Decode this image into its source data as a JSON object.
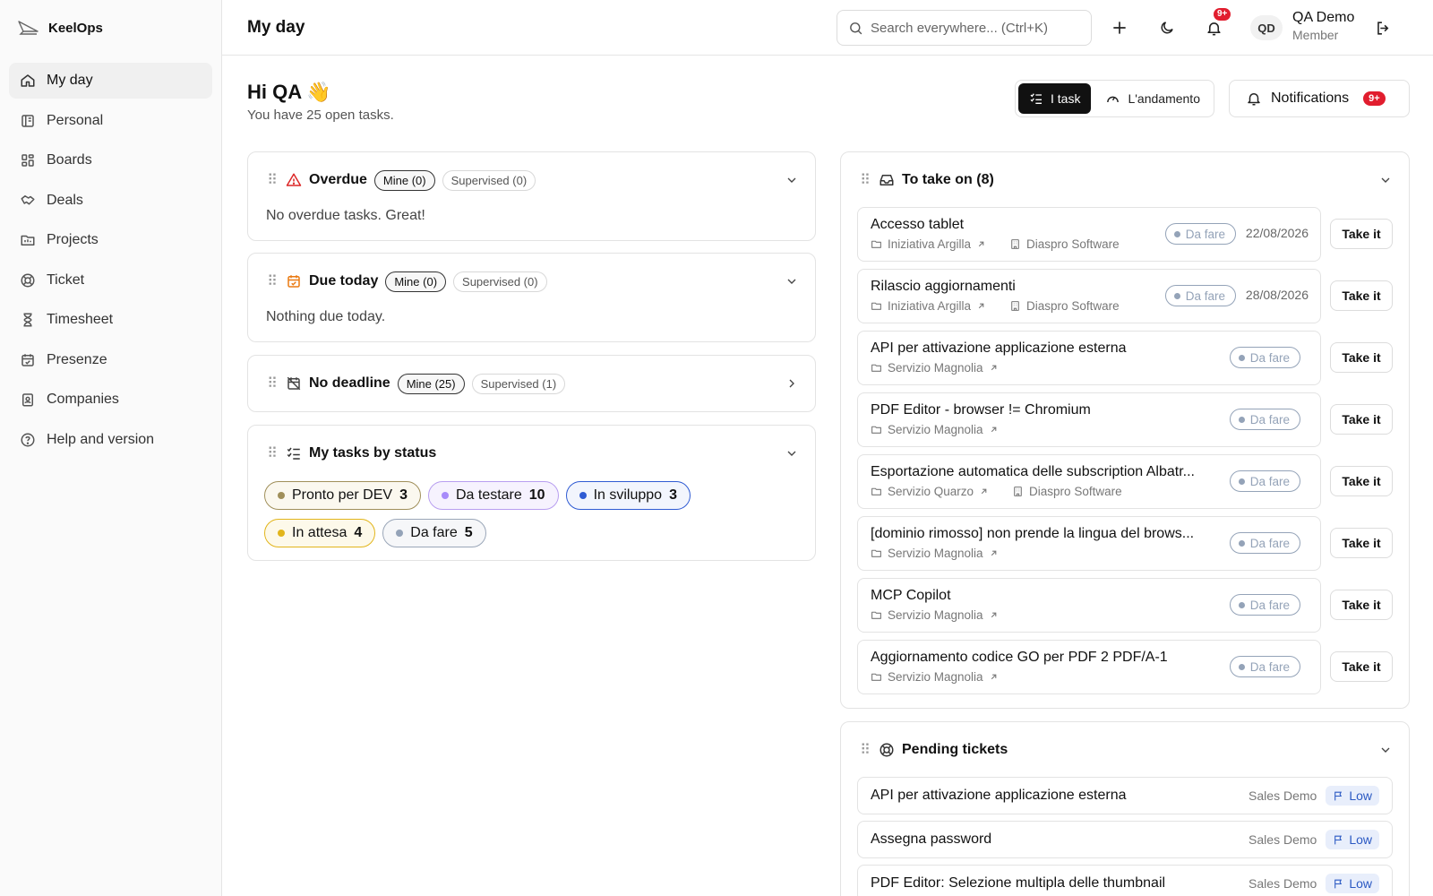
{
  "app": {
    "name": "KeelOps"
  },
  "sidebar": {
    "items": [
      {
        "label": "My day",
        "icon": "home-icon"
      },
      {
        "label": "Personal",
        "icon": "personal-board-icon"
      },
      {
        "label": "Boards",
        "icon": "boards-icon"
      },
      {
        "label": "Deals",
        "icon": "handshake-icon"
      },
      {
        "label": "Projects",
        "icon": "folder-icon"
      },
      {
        "label": "Ticket",
        "icon": "lifebuoy-icon"
      },
      {
        "label": "Timesheet",
        "icon": "hourglass-icon"
      },
      {
        "label": "Presenze",
        "icon": "calendar-check-icon"
      },
      {
        "label": "Companies",
        "icon": "building-icon"
      },
      {
        "label": "Help and version",
        "icon": "help-icon"
      }
    ]
  },
  "header": {
    "title": "My day",
    "search_placeholder": "Search everywhere... (Ctrl+K)",
    "bell_badge": "9+",
    "user": {
      "initials": "QD",
      "name": "QA Demo",
      "role": "Member"
    }
  },
  "greeting": {
    "title": "Hi QA 👋",
    "subtitle": "You have 25 open tasks."
  },
  "view_toggle": {
    "tasks": "I task",
    "progress": "L'andamento"
  },
  "notifications": {
    "label": "Notifications",
    "badge": "9+"
  },
  "overdue": {
    "title": "Overdue",
    "mine": "Mine (0)",
    "supervised": "Supervised (0)",
    "text": "No overdue tasks. Great!"
  },
  "due_today": {
    "title": "Due today",
    "mine": "Mine (0)",
    "supervised": "Supervised (0)",
    "text": "Nothing due today."
  },
  "no_deadline": {
    "title": "No deadline",
    "mine": "Mine (25)",
    "supervised": "Supervised (1)"
  },
  "by_status": {
    "title": "My tasks by status",
    "chips": [
      {
        "label": "Pronto per DEV",
        "count": "3",
        "color": "#a08f5a",
        "dot": "#a08f5a",
        "bg": "#fbf8ef"
      },
      {
        "label": "Da testare",
        "count": "10",
        "color": "#b89ef0",
        "dot": "#a78bfa",
        "bg": "#f6f2fe"
      },
      {
        "label": "In sviluppo",
        "count": "3",
        "color": "#2f5bd3",
        "dot": "#2f5bd3",
        "bg": "#f2f5fd"
      },
      {
        "label": "In attesa",
        "count": "4",
        "color": "#e2b51b",
        "dot": "#e2b51b",
        "bg": "#fdf9ea"
      },
      {
        "label": "Da fare",
        "count": "5",
        "color": "#9aa6b8",
        "dot": "#94a3b8",
        "bg": "#f6f7f9"
      }
    ]
  },
  "take_on": {
    "title": "To take on (8)",
    "take_label": "Take it",
    "tasks": [
      {
        "title": "Accesso tablet",
        "project": "Iniziativa Argilla",
        "company": "Diaspro Software",
        "status": "Da fare",
        "date": "22/08/2026"
      },
      {
        "title": "Rilascio aggiornamenti",
        "project": "Iniziativa Argilla",
        "company": "Diaspro Software",
        "status": "Da fare",
        "date": "28/08/2026"
      },
      {
        "title": "API per attivazione applicazione esterna",
        "project": "Servizio Magnolia",
        "company": "",
        "status": "Da fare",
        "date": ""
      },
      {
        "title": "PDF Editor - browser != Chromium",
        "project": "Servizio Magnolia",
        "company": "",
        "status": "Da fare",
        "date": ""
      },
      {
        "title": "Esportazione automatica delle subscription Albatr...",
        "project": "Servizio Quarzo",
        "company": "Diaspro Software",
        "status": "Da fare",
        "date": ""
      },
      {
        "title": "[dominio rimosso] non prende la lingua del brows...",
        "project": "Servizio Magnolia",
        "company": "",
        "status": "Da fare",
        "date": ""
      },
      {
        "title": "MCP Copilot",
        "project": "Servizio Magnolia",
        "company": "",
        "status": "Da fare",
        "date": ""
      },
      {
        "title": "Aggiornamento codice GO per PDF 2 PDF/A-1",
        "project": "Servizio Magnolia",
        "company": "",
        "status": "Da fare",
        "date": ""
      }
    ]
  },
  "pending_tickets": {
    "title": "Pending tickets",
    "tickets": [
      {
        "title": "API per attivazione applicazione esterna",
        "company": "Sales Demo",
        "priority": "Low"
      },
      {
        "title": "Assegna password",
        "company": "Sales Demo",
        "priority": "Low"
      },
      {
        "title": "PDF Editor: Selezione multipla delle thumbnail",
        "company": "Sales Demo",
        "priority": "Low"
      }
    ]
  }
}
